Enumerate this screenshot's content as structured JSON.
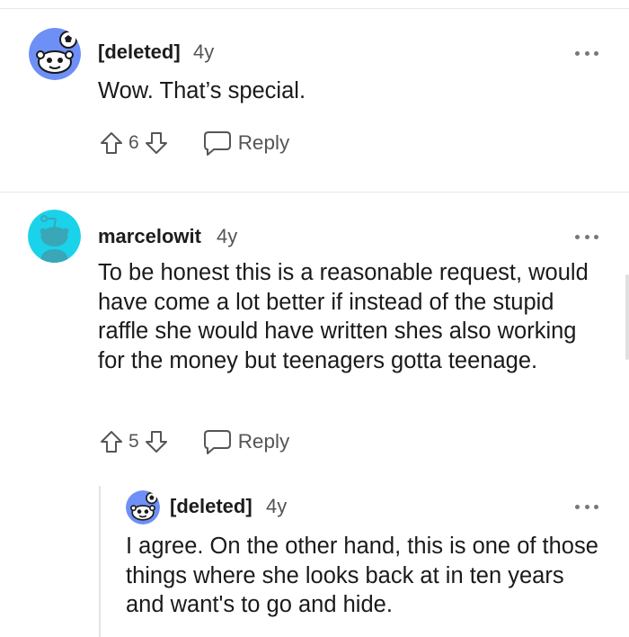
{
  "comments": [
    {
      "username": "[deleted]",
      "age": "4y",
      "avatar_icon": "snoo-soccer-avatar-icon",
      "body": "Wow. That’s special.",
      "score": "6",
      "reply_label": "Reply"
    },
    {
      "username": "marcelowit",
      "age": "4y",
      "avatar_icon": "snoo-teal-avatar-icon",
      "body": "To be honest this is a reasonable request, would have come a lot better if instead of the stupid raffle she would have written shes also working for the money but teenagers gotta teenage.",
      "score": "5",
      "reply_label": "Reply"
    },
    {
      "username": "[deleted]",
      "age": "4y",
      "avatar_icon": "snoo-soccer-avatar-icon",
      "body": "I agree. On the other hand, this is one of those things where she looks back at in ten years and want's to go and hide."
    }
  ],
  "colors": {
    "soccer_avatar_bg": "#6e8ff5",
    "teal_avatar_bg": "#1ad3ea",
    "text": "#1a1a1b",
    "muted": "#555555"
  }
}
